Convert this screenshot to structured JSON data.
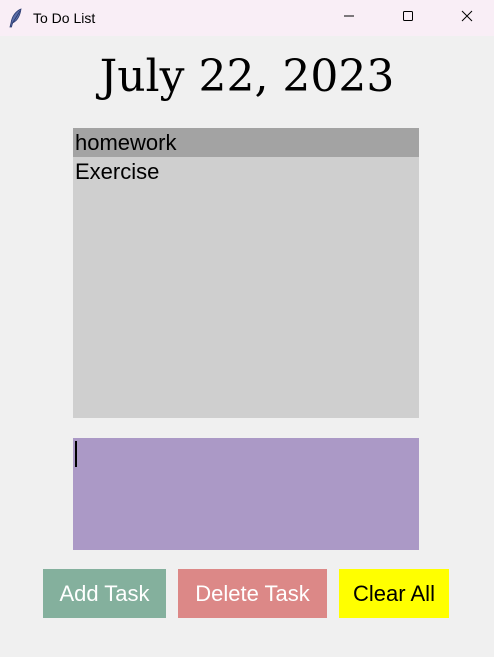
{
  "window": {
    "title": "To Do List"
  },
  "date": {
    "text": "July 22, 2023"
  },
  "tasks": {
    "items": [
      {
        "label": "homework",
        "selected": true
      },
      {
        "label": "Exercise",
        "selected": false
      }
    ]
  },
  "entry": {
    "value": "",
    "color": "#ab99c6"
  },
  "buttons": {
    "add_label": "Add Task",
    "delete_label": "Delete Task",
    "clear_label": "Clear All"
  },
  "colors": {
    "add": "#84b09d",
    "delete": "#dc8887",
    "clear": "#ffff00",
    "listbox": "#cfcfcf",
    "selection": "#a3a3a3"
  }
}
